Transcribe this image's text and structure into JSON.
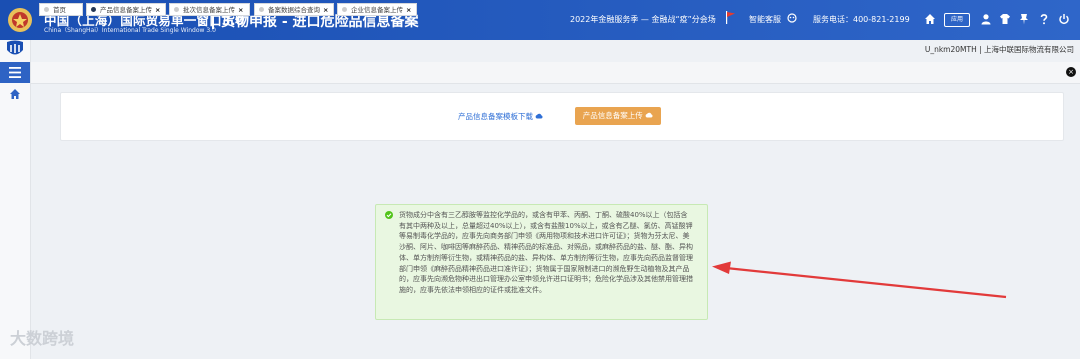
{
  "header": {
    "brand_cn": "中国（上海）国际贸易单一窗口3.0",
    "brand_en": "China（ShangHai）International  Trade Single  Window  3.0",
    "page_title": "货物申报 - 进口危险品信息备案",
    "promo": "2022年金融服务季 — 金融战“疫”分会场",
    "service_label": "智能客服",
    "phone": "服务电话：400-821-2199",
    "app_badge": "应用"
  },
  "user": {
    "info": "U_nkm20MTH | 上海中联国际物流有限公司"
  },
  "tabs": [
    {
      "label": "首页",
      "closable": false,
      "active": false
    },
    {
      "label": "产品信息备案上传",
      "closable": true,
      "active": true
    },
    {
      "label": "批次信息备案上传",
      "closable": true,
      "active": false
    },
    {
      "label": "备案数据综合查询",
      "closable": true,
      "active": false
    },
    {
      "label": "企业信息备案上传",
      "closable": true,
      "active": false
    }
  ],
  "close_symbol": "×",
  "panel": {
    "download_link": "产品信息备案模板下载",
    "upload_button": "产品信息备案上传"
  },
  "notice": {
    "message": "货物成分中含有三乙醇胺等监控化学品的，或含有甲苯、丙酮、丁酮、硫酸40%以上（包括含有其中两种及以上，总量超过40%以上），或含有盐酸10%以上，或含有乙醚、氯仿、高锰酸钾等易制毒化学品的，应事先向商务部门申领《两用物项和技术进口许可证》；货物为芬太尼、美沙酮、阿片、咖啡因等麻醉药品、精神药品的标准品、对照品，或麻醉药品的盐、醚、酯、异构体、单方制剂等衍生物，或精神药品的盐、异构体、单方制剂等衍生物，应事先向药品监督管理部门申领《麻醉药品精神药品进口准许证》；货物属于国家限制进口的濒危野生动植物及其产品的，应事先向濒危物种进出口管理办公室申领允许进口证明书；危险化学品涉及其他禁用管理措施的，应事先依法申领相应的证件或批准文件。"
  },
  "watermark": "大数跨境",
  "colors": {
    "header": "#1a4fb3",
    "accent_button": "#e9a450",
    "link": "#2f6fd6",
    "notice_bg": "#e9f7e1",
    "arrow": "#e23a3a"
  }
}
